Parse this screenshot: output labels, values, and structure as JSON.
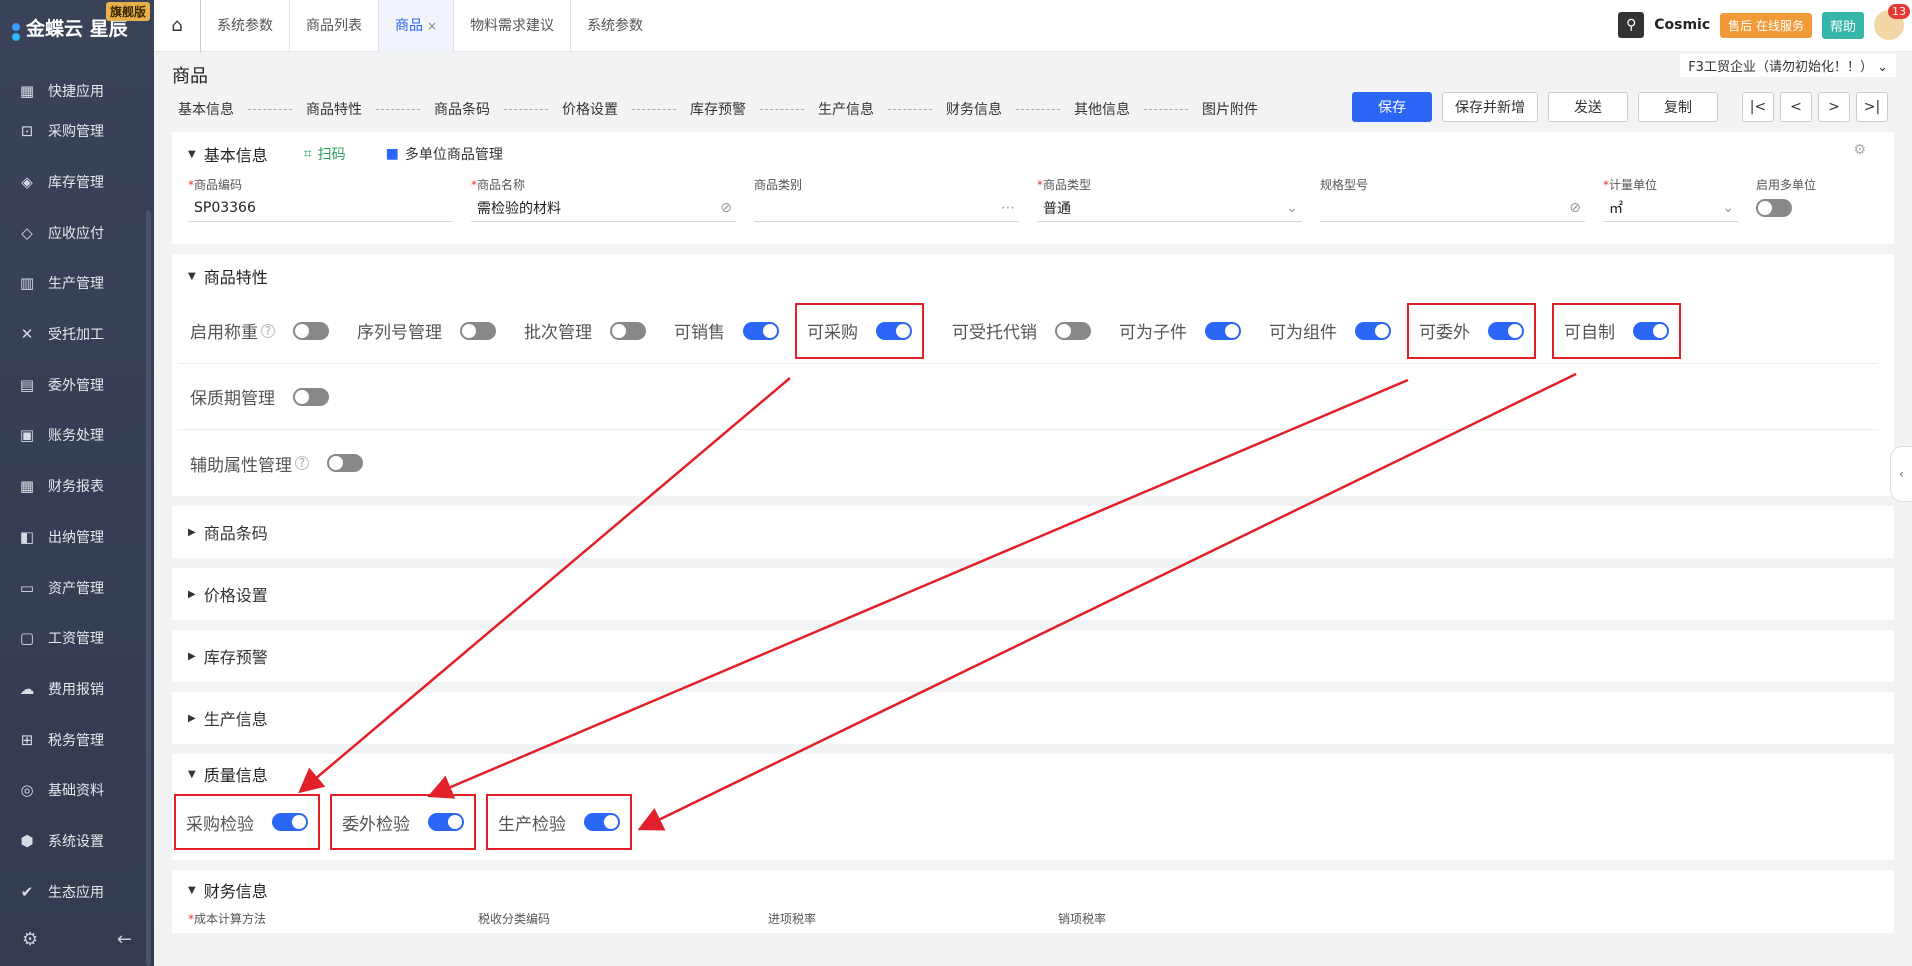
{
  "app": {
    "logo_text": "金蝶云 星辰",
    "logo_badge": "旗舰版"
  },
  "sidebar": {
    "items": [
      {
        "label": "快捷应用",
        "icon": "apps-icon"
      },
      {
        "label": "采购管理",
        "icon": "cart-icon"
      },
      {
        "label": "库存管理",
        "icon": "box-icon"
      },
      {
        "label": "应收应付",
        "icon": "diamond-icon"
      },
      {
        "label": "生产管理",
        "icon": "factory-icon"
      },
      {
        "label": "受托加工",
        "icon": "tools-icon"
      },
      {
        "label": "委外管理",
        "icon": "outsource-icon"
      },
      {
        "label": "账务处理",
        "icon": "ledger-icon"
      },
      {
        "label": "财务报表",
        "icon": "report-icon"
      },
      {
        "label": "出纳管理",
        "icon": "cashier-icon"
      },
      {
        "label": "资产管理",
        "icon": "asset-icon"
      },
      {
        "label": "工资管理",
        "icon": "salary-icon"
      },
      {
        "label": "费用报销",
        "icon": "expense-icon"
      },
      {
        "label": "税务管理",
        "icon": "tax-icon"
      },
      {
        "label": "基础资料",
        "icon": "layers-icon"
      },
      {
        "label": "系统设置",
        "icon": "settings-icon"
      },
      {
        "label": "生态应用",
        "icon": "eco-icon"
      }
    ]
  },
  "tabs": [
    {
      "label": "系统参数"
    },
    {
      "label": "商品列表"
    },
    {
      "label": "商品",
      "active": true,
      "close": "×"
    },
    {
      "label": "物料需求建议"
    },
    {
      "label": "系统参数"
    }
  ],
  "topright": {
    "cosmic": "Cosmic",
    "service": "售后 在线服务",
    "help": "帮助",
    "notif_count": "13"
  },
  "page": {
    "title": "商品",
    "org": "F3工贸企业（请勿初始化！！）"
  },
  "anchors": [
    "基本信息",
    "商品特性",
    "商品条码",
    "价格设置",
    "库存预警",
    "生产信息",
    "财务信息",
    "其他信息",
    "图片附件"
  ],
  "actions": {
    "save": "保存",
    "save_new": "保存并新增",
    "send": "发送",
    "copy": "复制"
  },
  "basic": {
    "title": "基本信息",
    "scan": "扫码",
    "multi_unit": "多单位商品管理",
    "fields": {
      "code": {
        "label": "商品编码",
        "value": "SP03366"
      },
      "name": {
        "label": "商品名称",
        "value": "需检验的材料"
      },
      "category": {
        "label": "商品类别",
        "value": ""
      },
      "type": {
        "label": "商品类型",
        "value": "普通"
      },
      "spec": {
        "label": "规格型号",
        "value": ""
      },
      "unit": {
        "label": "计量单位",
        "value": "㎡"
      },
      "multi": {
        "label": "启用多单位"
      }
    }
  },
  "features": {
    "title": "商品特性",
    "row1": [
      {
        "label": "启用称重",
        "on": false,
        "help": "?"
      },
      {
        "label": "序列号管理",
        "on": false
      },
      {
        "label": "批次管理",
        "on": false
      },
      {
        "label": "可销售",
        "on": true
      },
      {
        "label": "可采购",
        "on": true,
        "hl": true
      },
      {
        "label": "可受托代销",
        "on": false
      },
      {
        "label": "可为子件",
        "on": true
      },
      {
        "label": "可为组件",
        "on": true
      },
      {
        "label": "可委外",
        "on": true,
        "hl": true
      },
      {
        "label": "可自制",
        "on": true,
        "hl": true
      }
    ],
    "shelf": "保质期管理",
    "aux": "辅助属性管理",
    "aux_help": "?"
  },
  "sections": {
    "barcode": "商品条码",
    "price": "价格设置",
    "stock": "库存预警",
    "production": "生产信息"
  },
  "quality": {
    "title": "质量信息",
    "items": [
      {
        "label": "采购检验",
        "on": true
      },
      {
        "label": "委外检验",
        "on": true
      },
      {
        "label": "生产检验",
        "on": true
      }
    ]
  },
  "finance": {
    "title": "财务信息",
    "fields": [
      "成本计算方法",
      "税收分类编码",
      "进项税率",
      "销项税率"
    ]
  },
  "colors": {
    "primary": "#2b66f6",
    "highlight": "#e2202a",
    "sidebar": "#363d52"
  }
}
